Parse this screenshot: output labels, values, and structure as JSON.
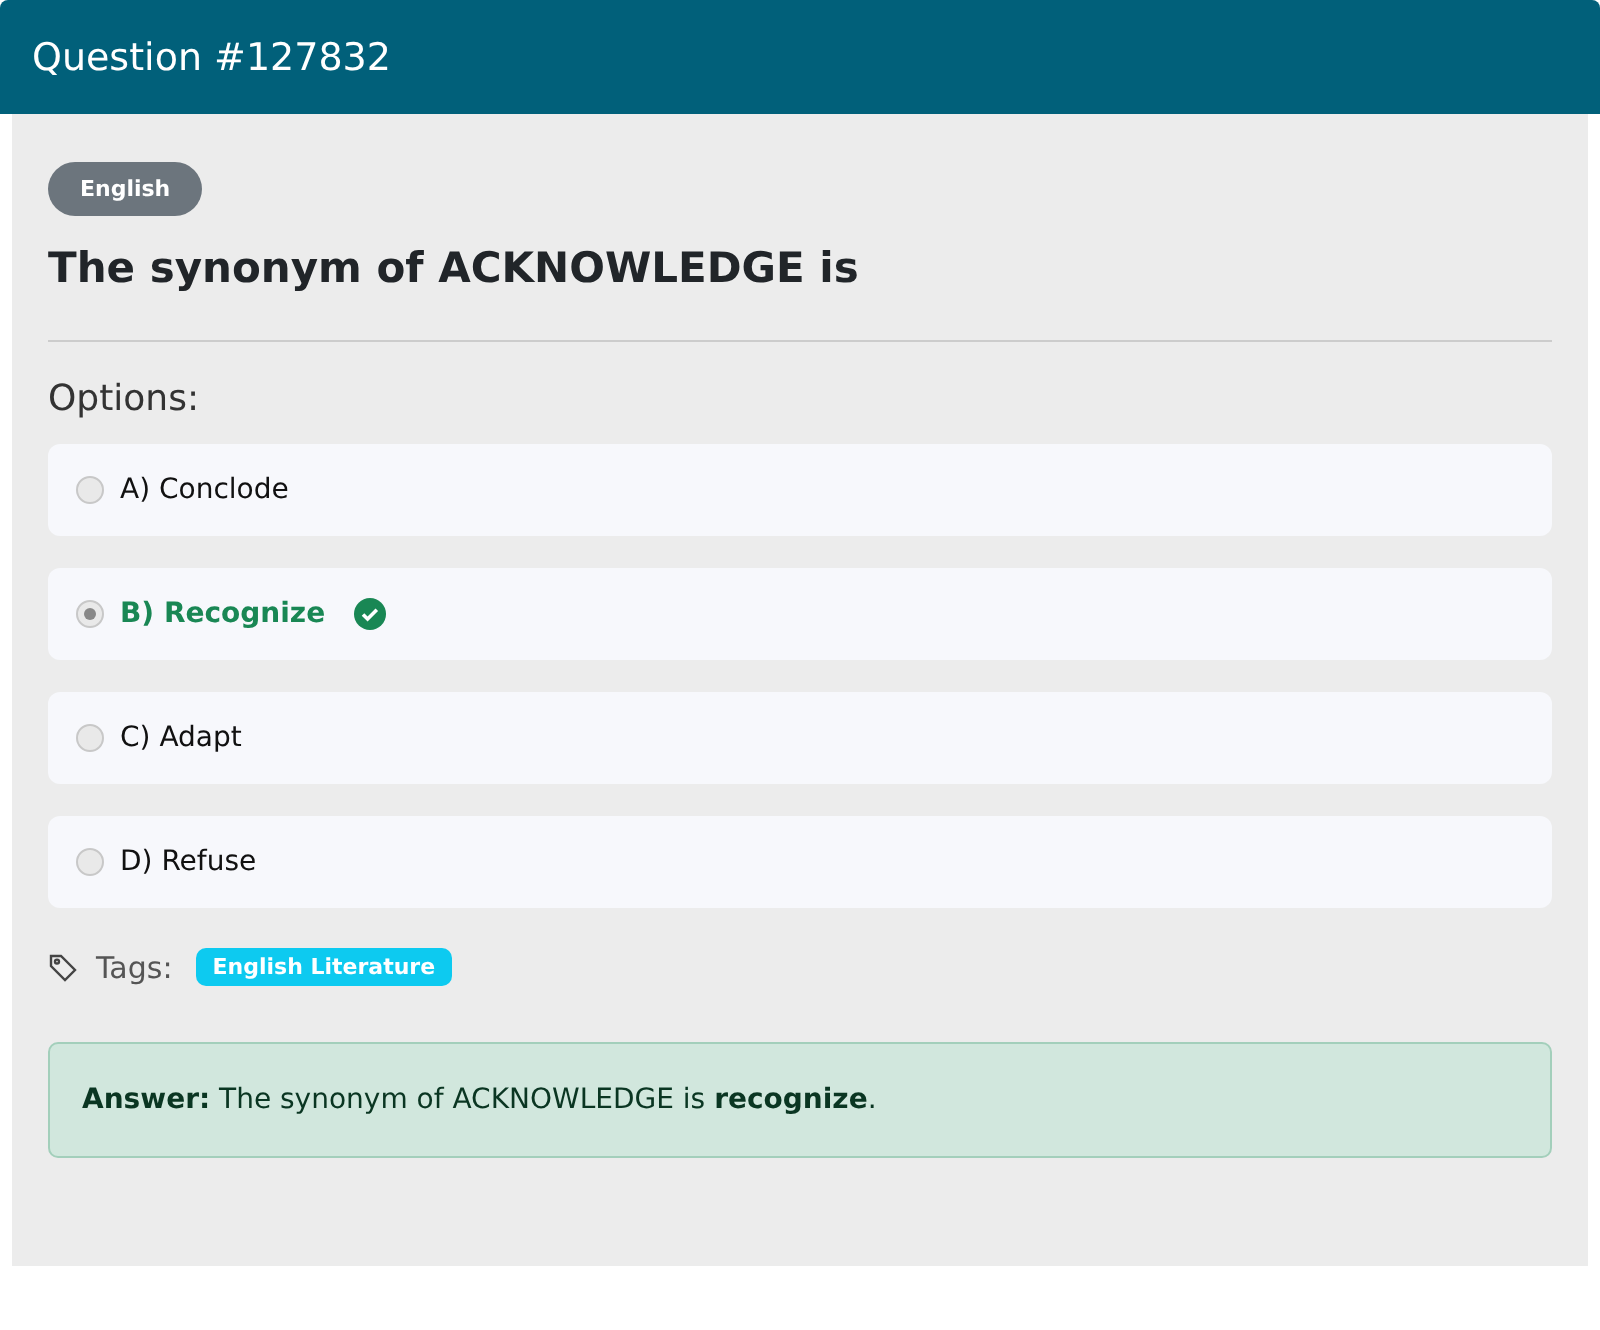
{
  "header": {
    "title": "Question #127832"
  },
  "category": "English",
  "question": "The synonym of ACKNOWLEDGE is",
  "options_label": "Options:",
  "options": [
    {
      "label": "A) Conclode",
      "selected": false,
      "correct": false
    },
    {
      "label": "B) Recognize",
      "selected": true,
      "correct": true
    },
    {
      "label": "C) Adapt",
      "selected": false,
      "correct": false
    },
    {
      "label": "D) Refuse",
      "selected": false,
      "correct": false
    }
  ],
  "tags_label": "Tags:",
  "tags": [
    "English Literature"
  ],
  "answer": "**Answer:** The synonym of ACKNOWLEDGE is **recognize**."
}
